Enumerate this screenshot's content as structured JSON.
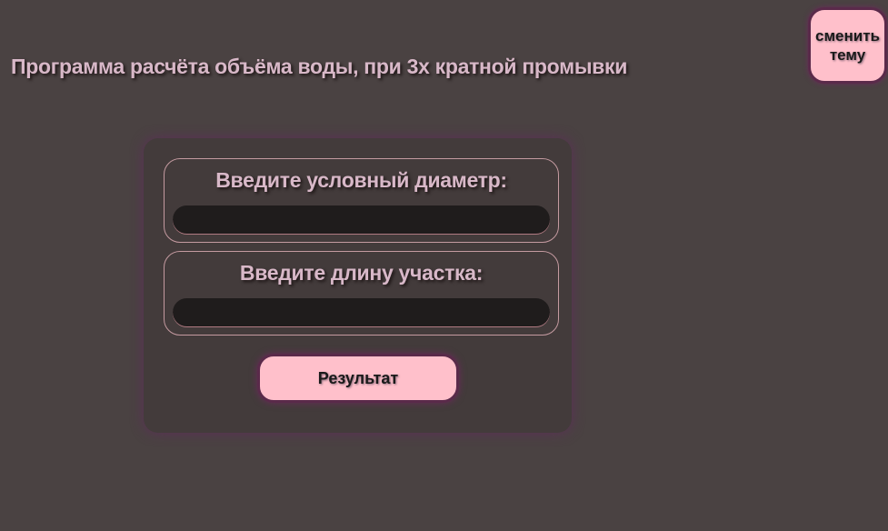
{
  "header": {
    "title": "Программа расчёта объёма воды, при 3х кратной промывки",
    "theme_button_label": "сменить тему"
  },
  "form": {
    "diameter": {
      "label": "Введите условный диаметр:",
      "value": "",
      "placeholder": ""
    },
    "length": {
      "label": "Введите длину участка:",
      "value": "",
      "placeholder": ""
    },
    "submit_label": "Результат"
  },
  "colors": {
    "background": "#4a4242",
    "card": "#433b3b",
    "accent_button": "#ffc0cb",
    "text_light": "#d8b8c8",
    "input_bg": "#1f1c1c"
  }
}
